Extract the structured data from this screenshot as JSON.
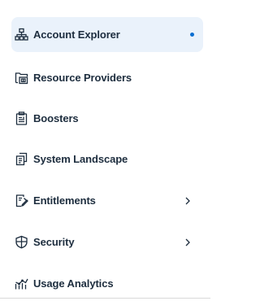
{
  "nav": {
    "items": [
      {
        "label": "Account Explorer",
        "icon": "hierarchy-icon",
        "selected": true,
        "indicator_dot": true,
        "has_submenu": false
      },
      {
        "label": "Resource Providers",
        "icon": "resource-folder-icon",
        "selected": false,
        "has_submenu": false
      },
      {
        "label": "Boosters",
        "icon": "clipboard-icon",
        "selected": false,
        "has_submenu": false
      },
      {
        "label": "System Landscape",
        "icon": "documents-icon",
        "selected": false,
        "has_submenu": false
      },
      {
        "label": "Entitlements",
        "icon": "edit-document-icon",
        "selected": false,
        "has_submenu": true
      },
      {
        "label": "Security",
        "icon": "shield-icon",
        "selected": false,
        "has_submenu": true
      },
      {
        "label": "Usage Analytics",
        "icon": "analytics-icon",
        "selected": false,
        "has_submenu": false
      }
    ]
  },
  "colors": {
    "selected_background": "#eaf2fb",
    "indicator_dot": "#0a6ed1",
    "text": "#1d2d3e"
  }
}
